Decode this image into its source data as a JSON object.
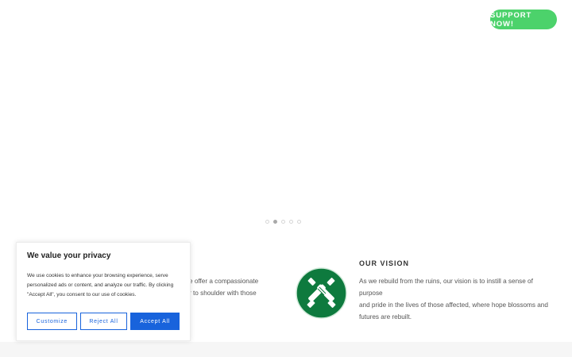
{
  "header": {
    "support_label": "SUPPORT NOW!"
  },
  "slider": {
    "dots": 5,
    "active_index": 1
  },
  "mission": {
    "text_lines": [
      "e offer a compassionate",
      "r to shoulder with those"
    ]
  },
  "vision": {
    "title": "OUR VISION",
    "icon": "hands-together-icon",
    "text_lines": [
      "As we rebuild from the ruins, our vision is to instill a sense of purpose",
      "and pride in the lives of those affected, where hope blossoms and",
      "futures are rebuilt."
    ]
  },
  "cookie": {
    "title": "We value your privacy",
    "text_lines": [
      "We use cookies to enhance your browsing experience, serve",
      "personalized ads or content, and analyze our traffic. By clicking",
      "\"Accept All\", you consent to our use of cookies."
    ],
    "customize_label": "Customize",
    "reject_label": "Reject All",
    "accept_label": "Accept All"
  },
  "colors": {
    "support_button": "#4cd26b",
    "vision_icon": "#0e7a3e",
    "cookie_accent": "#1863dc"
  }
}
